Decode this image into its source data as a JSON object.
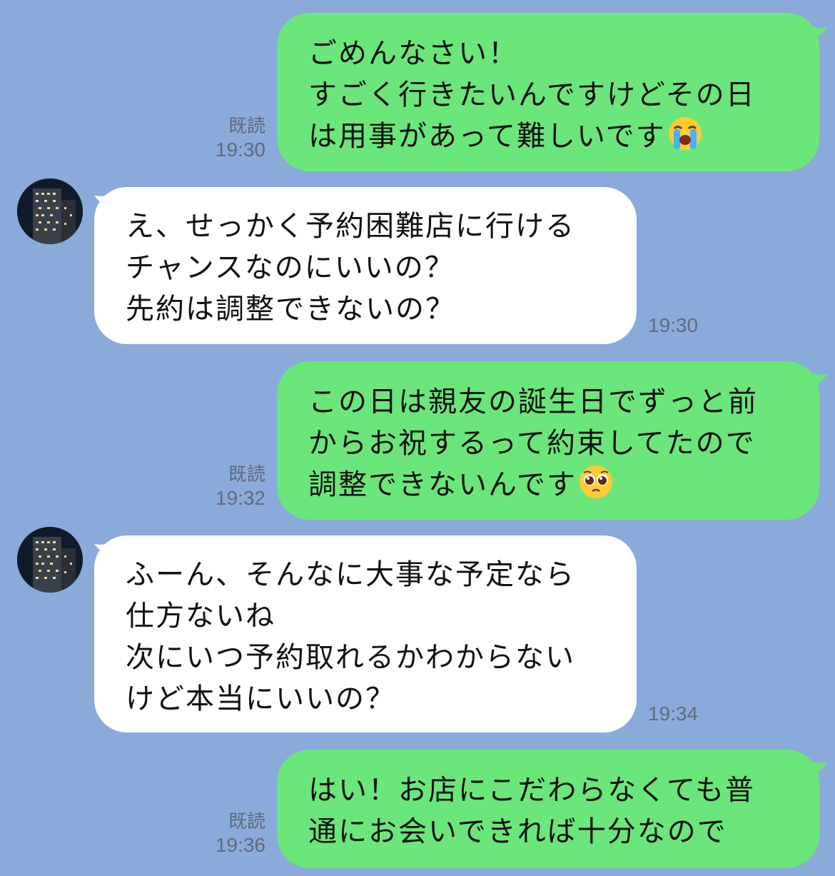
{
  "chat": {
    "messages": [
      {
        "side": "sent",
        "text": "ごめんなさい！\nすごく行きたいんですけどその日\nは用事があって難しいです",
        "emoji": "loudly-crying-face-icon",
        "read": "既読",
        "time": "19:30"
      },
      {
        "side": "received",
        "text": "え、せっかく予約困難店に行ける\nチャンスなのにいいの？\n先約は調整できないの？",
        "time": "19:30"
      },
      {
        "side": "sent",
        "text": "この日は親友の誕生日でずっと前\nからお祝するって約束してたので\n調整できないんです",
        "emoji": "pleading-face-icon",
        "read": "既読",
        "time": "19:32"
      },
      {
        "side": "received",
        "text": "ふーん、そんなに大事な予定なら\n仕方ないね\n次にいつ予約取れるかわからない\nけど本当にいいの？",
        "time": "19:34"
      },
      {
        "side": "sent",
        "text": "はい！お店にこだわらなくても普\n通にお会いできれば十分なので",
        "read": "既読",
        "time": "19:36"
      }
    ]
  },
  "colors": {
    "background": "#8aabd9",
    "sent_bubble": "#6be67a",
    "received_bubble": "#ffffff",
    "meta_text": "#5f6a7a"
  }
}
